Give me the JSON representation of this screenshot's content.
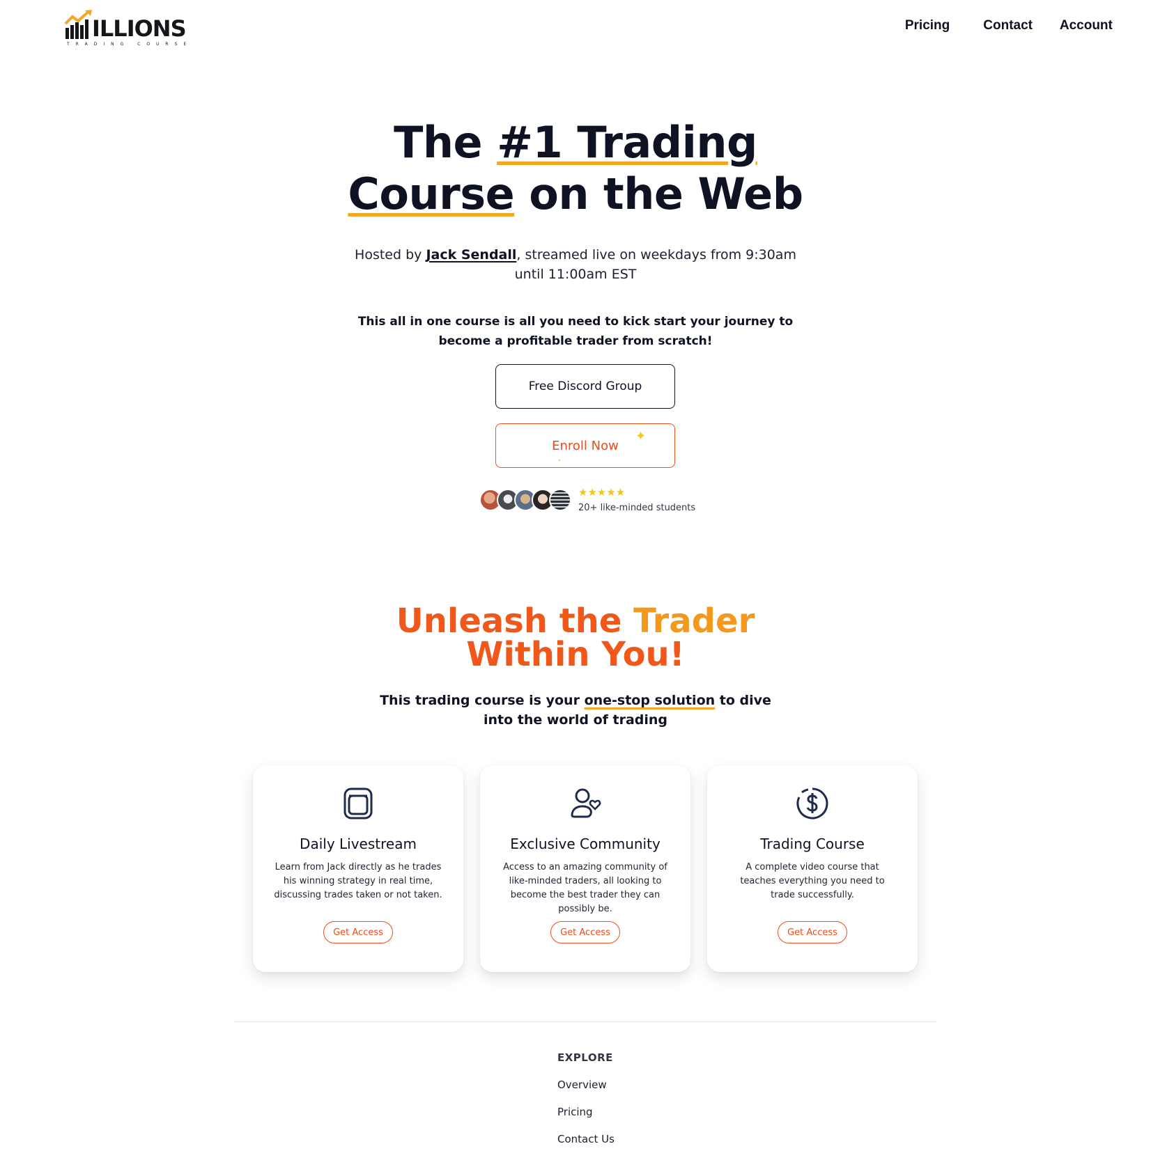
{
  "brand": {
    "logo_word": "ILLIONS",
    "logo_sub": "TRADING COURSE",
    "accent_orange": "#f04e1c",
    "accent_gold": "#f5a623",
    "text_dark": "#0f1222"
  },
  "nav": {
    "items": [
      "Pricing",
      "Contact",
      "Account"
    ]
  },
  "hero": {
    "title_the": "The ",
    "title_ul1": "#1 Trading",
    "title_ul2": "Course",
    "title_rest": " on the Web",
    "hosted_pre": "Hosted by ",
    "hosted_name": "Jack Sendall",
    "hosted_post": ", streamed live on weekdays from 9:30am",
    "hosted_line2": "until 11:00am EST",
    "pitch_line1": "This all in one course is all you need to kick start your journey to",
    "pitch_line2": "become a profitable trader from scratch!",
    "discord_label": "Free Discord Group",
    "enroll_label": "Enroll Now",
    "stars": "★★★★★",
    "students_label": "20+ like-minded students"
  },
  "section": {
    "unleash_line1a": "Unleash the ",
    "unleash_line1b": "Trader",
    "unleash_line2": "Within You!",
    "sub_pre": "This trading course is your ",
    "sub_ul": "one-stop solution",
    "sub_post": " to dive",
    "sub_line2": "into the world of trading"
  },
  "cards": [
    {
      "icon": "livestream-icon",
      "title": "Daily Livestream",
      "desc": "Learn from Jack directly as he trades his winning strategy in real time, discussing trades taken or not taken.",
      "cta": "Get Access"
    },
    {
      "icon": "community-icon",
      "title": "Exclusive Community",
      "desc": "Access to an amazing community of like-minded traders, all looking to become the best trader they can possibly be.",
      "cta": "Get Access"
    },
    {
      "icon": "dollar-icon",
      "title": "Trading Course",
      "desc": "A complete video course that teaches everything you need to trade successfully.",
      "cta": "Get Access"
    }
  ],
  "footer": {
    "heading": "EXPLORE",
    "links": [
      "Overview",
      "Pricing",
      "Contact Us"
    ]
  }
}
